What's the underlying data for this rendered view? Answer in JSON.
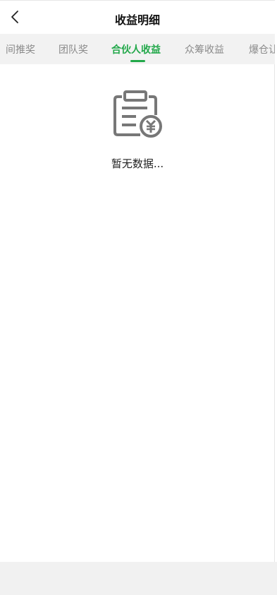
{
  "header": {
    "title": "收益明细"
  },
  "tabs": [
    {
      "label": "间推奖"
    },
    {
      "label": "团队奖"
    },
    {
      "label": "合伙人收益"
    },
    {
      "label": "众筹收益"
    },
    {
      "label": "爆仓让"
    }
  ],
  "empty_state": {
    "icon": "clipboard-yuan-icon",
    "text": "暂无数据..."
  },
  "colors": {
    "accent": "#22a84a",
    "tabbar_bg": "#f2f2f2",
    "bottom_bg": "#f1f1f1"
  }
}
